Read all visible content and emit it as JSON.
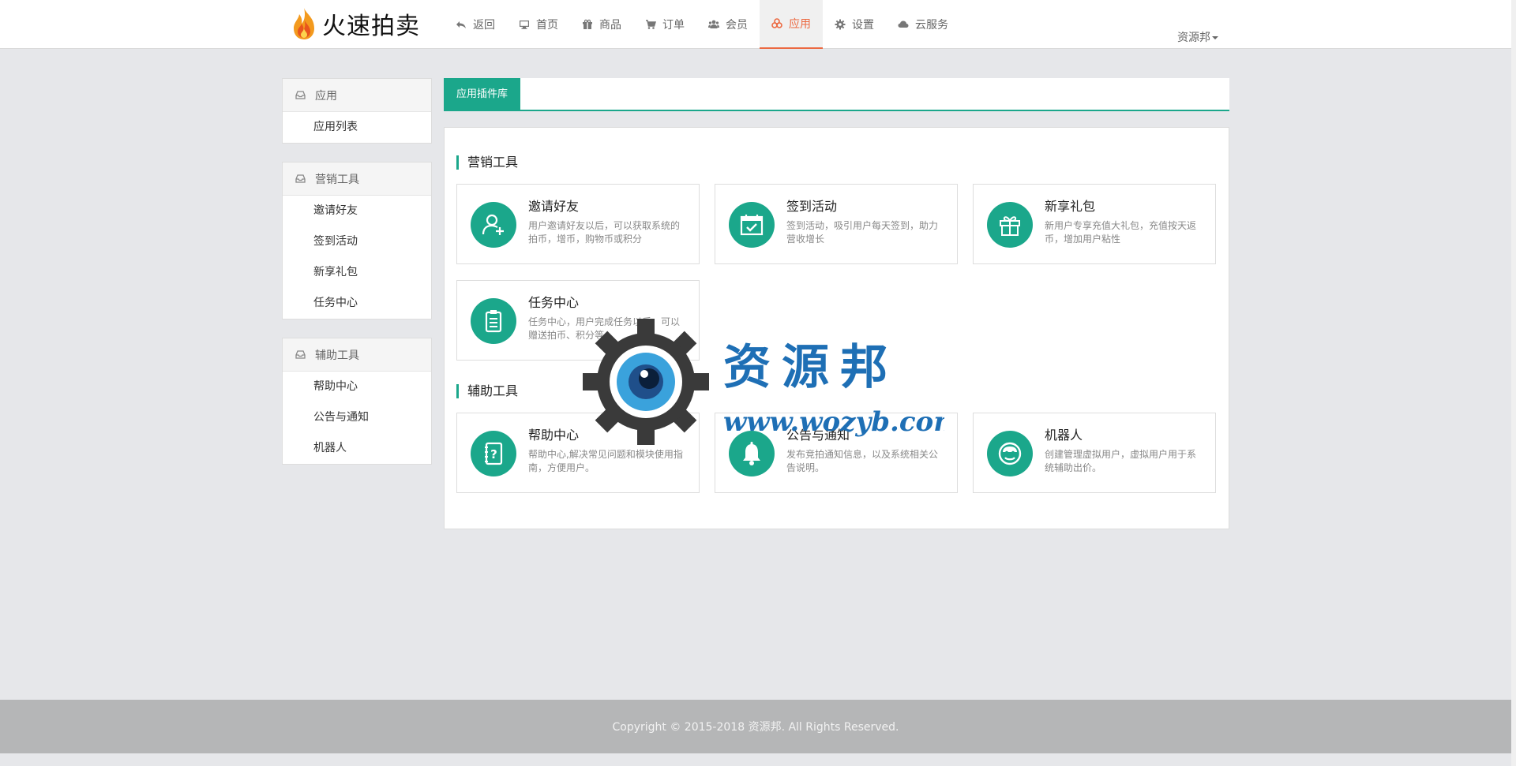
{
  "app": {
    "name": "火速拍卖"
  },
  "nav": {
    "items": [
      {
        "label": "返回",
        "icon": "reply-icon"
      },
      {
        "label": "首页",
        "icon": "monitor-icon"
      },
      {
        "label": "商品",
        "icon": "gift-icon"
      },
      {
        "label": "订单",
        "icon": "cart-icon"
      },
      {
        "label": "会员",
        "icon": "users-icon"
      },
      {
        "label": "应用",
        "icon": "apps-icon",
        "active": true
      },
      {
        "label": "设置",
        "icon": "gear-icon"
      },
      {
        "label": "云服务",
        "icon": "cloud-icon"
      }
    ],
    "user": "资源邦"
  },
  "sidebar": {
    "groups": [
      {
        "title": "应用",
        "items": [
          "应用列表"
        ]
      },
      {
        "title": "营销工具",
        "items": [
          "邀请好友",
          "签到活动",
          "新享礼包",
          "任务中心"
        ]
      },
      {
        "title": "辅助工具",
        "items": [
          "帮助中心",
          "公告与通知",
          "机器人"
        ]
      }
    ]
  },
  "main": {
    "tab": "应用插件库",
    "sections": [
      {
        "title": "营销工具",
        "cards": [
          {
            "title": "邀请好友",
            "desc": "用户邀请好友以后，可以获取系统的拍币，增币，购物币或积分",
            "icon": "user-plus-icon"
          },
          {
            "title": "签到活动",
            "desc": "签到活动，吸引用户每天签到，助力营收增长",
            "icon": "calendar-check-icon"
          },
          {
            "title": "新享礼包",
            "desc": "新用户专享充值大礼包，充值按天返币，增加用户粘性",
            "icon": "gift-box-icon"
          },
          {
            "title": "任务中心",
            "desc": "任务中心，用户完成任务以后，可以赠送拍币、积分等",
            "icon": "clipboard-icon"
          }
        ]
      },
      {
        "title": "辅助工具",
        "cards": [
          {
            "title": "帮助中心",
            "desc": "帮助中心,解决常见问题和模块使用指南，方便用户。",
            "icon": "help-book-icon"
          },
          {
            "title": "公告与通知",
            "desc": "发布竞拍通知信息，以及系统相关公告说明。",
            "icon": "bell-icon"
          },
          {
            "title": "机器人",
            "desc": "创建管理虚拟用户，虚拟用户用于系统辅助出价。",
            "icon": "robot-icon"
          }
        ]
      }
    ]
  },
  "footer": {
    "copyright": "Copyright © 2015-2018 资源邦. All Rights Reserved."
  },
  "watermark": {
    "text": "资源邦",
    "url": "www.wozyb.com"
  },
  "colors": {
    "accent": "#1ba78b",
    "nav_active": "#ec6941",
    "footer_bg": "#b5b6b7"
  }
}
